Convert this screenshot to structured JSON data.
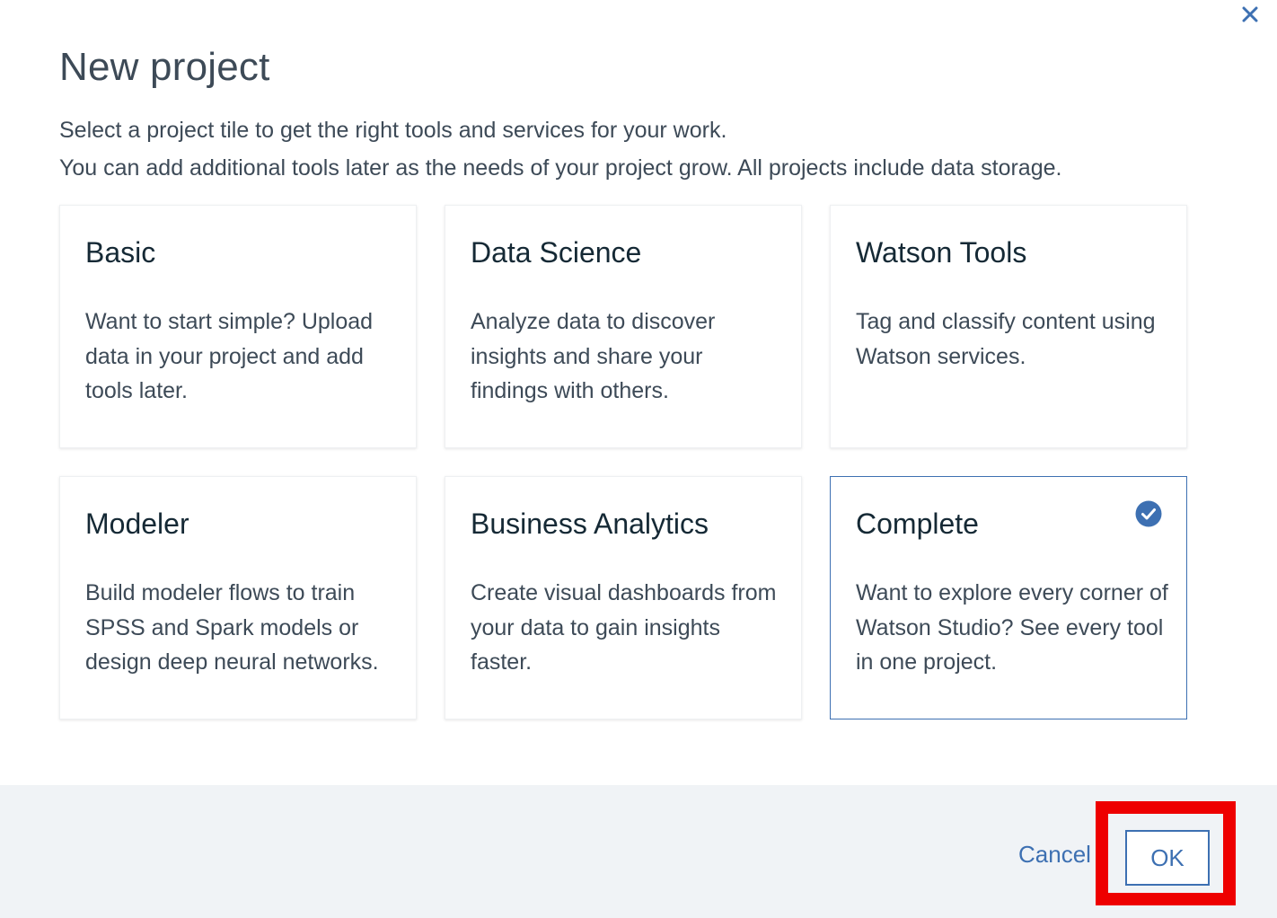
{
  "dialog": {
    "title": "New project",
    "intro_line_1": "Select a project tile to get the right tools and services for your work.",
    "intro_line_2": "You can add additional tools later as the needs of your project grow. All projects include data storage.",
    "close_icon": "close-icon"
  },
  "tiles": [
    {
      "title": "Basic",
      "description": "Want to start simple? Upload data in your project and add tools later.",
      "selected": false
    },
    {
      "title": "Data Science",
      "description": "Analyze data to discover insights and share your findings with others.",
      "selected": false
    },
    {
      "title": "Watson Tools",
      "description": "Tag and classify content using Watson services.",
      "selected": false
    },
    {
      "title": "Modeler",
      "description": "Build modeler flows to train SPSS and Spark models or design deep neural networks.",
      "selected": false
    },
    {
      "title": "Business Analytics",
      "description": "Create visual dashboards from your data to gain insights faster.",
      "selected": false
    },
    {
      "title": "Complete",
      "description": "Want to explore every corner of Watson Studio? See every tool in one project.",
      "selected": true
    }
  ],
  "footer": {
    "cancel_label": "Cancel",
    "ok_label": "OK"
  },
  "colors": {
    "accent": "#3d70b2",
    "highlight": "#ee0000",
    "footer_bg": "#f0f3f6"
  }
}
